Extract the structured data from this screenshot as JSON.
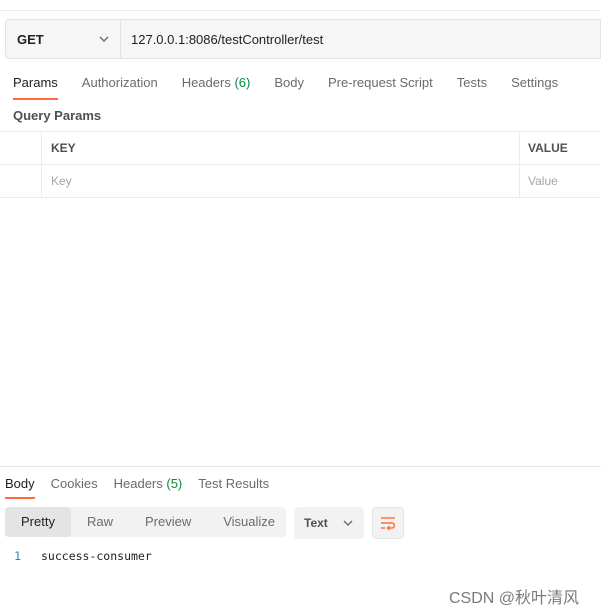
{
  "request": {
    "method": "GET",
    "url": "127.0.0.1:8086/testController/test"
  },
  "request_tabs": {
    "params": "Params",
    "authorization": "Authorization",
    "headers": "Headers",
    "headers_count": "(6)",
    "body": "Body",
    "prerequest": "Pre-request Script",
    "tests": "Tests",
    "settings": "Settings"
  },
  "query_params": {
    "title": "Query Params",
    "columns": {
      "key": "KEY",
      "value": "VALUE"
    },
    "placeholder_row": {
      "key": "Key",
      "value": "Value"
    }
  },
  "response_tabs": {
    "body": "Body",
    "cookies": "Cookies",
    "headers": "Headers",
    "headers_count": "(5)",
    "test_results": "Test Results"
  },
  "response_format": {
    "pretty": "Pretty",
    "raw": "Raw",
    "preview": "Preview",
    "visualize": "Visualize",
    "selected_type": "Text"
  },
  "response_body": {
    "line_number": "1",
    "content": "success-consumer"
  },
  "watermark": "CSDN @秋叶清风",
  "colors": {
    "accent": "#ff6c37",
    "count_green": "#0cbb52",
    "line_number": "#1e88c7"
  },
  "icons": {
    "method_dropdown": "chevron-down-icon",
    "type_dropdown": "chevron-down-icon",
    "wrap": "wrap-lines-icon"
  }
}
